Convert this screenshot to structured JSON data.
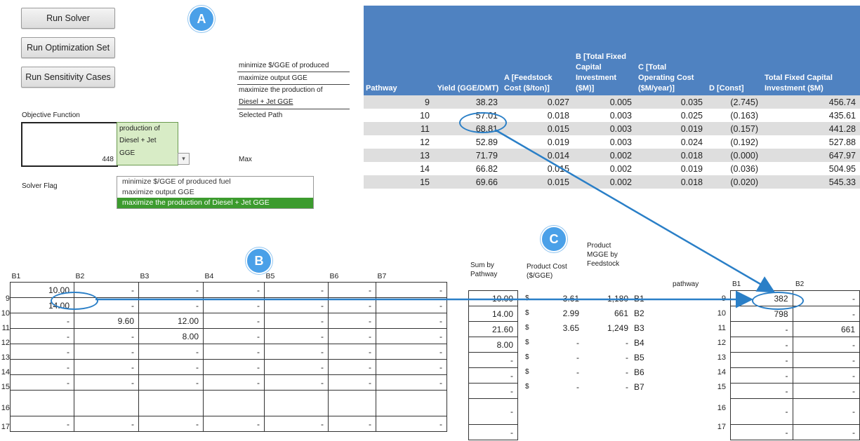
{
  "controls": {
    "run_solver": "Run Solver",
    "run_optimization_set": "Run Optimization Set",
    "run_sensitivity_cases": "Run Sensitivity Cases"
  },
  "objective": {
    "options": [
      "minimize $/GGE of produced",
      "maximize output GGE",
      "maximize the production of",
      "Diesel + Jet GGE"
    ],
    "selected_path_label": "Selected Path",
    "objective_function_label": "Objective Function",
    "value": "448",
    "dropdown_text": [
      "production of",
      "Diesel + Jet",
      "GGE"
    ],
    "max_label": "Max",
    "solver_flag_label": "Solver Flag",
    "list_options": [
      "minimize $/GGE of produced fuel",
      "maximize output GGE",
      "maximize the production of Diesel + Jet GGE"
    ]
  },
  "badges": {
    "a": "A",
    "b": "B",
    "c": "C"
  },
  "pathway_table": {
    "headers": [
      "Pathway",
      "Yield (GGE/DMT)",
      "A [Feedstock Cost ($/ton)]",
      "B [Total Fixed Capital Investment ($M)]",
      "C [Total Operating Cost ($M/year)]",
      "D [Const]",
      "Total Fixed Capital Investment ($M)"
    ],
    "rows": [
      [
        "9",
        "38.23",
        "0.027",
        "0.005",
        "0.035",
        "(2.745)",
        "456.74"
      ],
      [
        "10",
        "57.01",
        "0.018",
        "0.003",
        "0.025",
        "(0.163)",
        "435.61"
      ],
      [
        "11",
        "68.81",
        "0.015",
        "0.003",
        "0.019",
        "(0.157)",
        "441.28"
      ],
      [
        "12",
        "52.89",
        "0.019",
        "0.003",
        "0.024",
        "(0.192)",
        "527.88"
      ],
      [
        "13",
        "71.79",
        "0.014",
        "0.002",
        "0.018",
        "(0.000)",
        "647.97"
      ],
      [
        "14",
        "66.82",
        "0.015",
        "0.002",
        "0.019",
        "(0.036)",
        "504.95"
      ],
      [
        "15",
        "69.66",
        "0.015",
        "0.002",
        "0.018",
        "(0.020)",
        "545.33"
      ]
    ]
  },
  "b_grid": {
    "headers": [
      "B1",
      "B2",
      "B3",
      "B4",
      "B5",
      "B6",
      "B7"
    ],
    "row_labels": [
      "9",
      "10",
      "11",
      "12",
      "13",
      "14",
      "15",
      "16",
      "17"
    ],
    "rows": [
      [
        "10.00",
        "-",
        "-",
        "-",
        "-",
        "-",
        "-"
      ],
      [
        "14.00",
        "-",
        "-",
        "-",
        "-",
        "-",
        "-"
      ],
      [
        "-",
        "9.60",
        "12.00",
        "-",
        "-",
        "-",
        "-"
      ],
      [
        "-",
        "-",
        "8.00",
        "-",
        "-",
        "-",
        "-"
      ],
      [
        "-",
        "-",
        "-",
        "-",
        "-",
        "-",
        "-"
      ],
      [
        "-",
        "-",
        "-",
        "-",
        "-",
        "-",
        "-"
      ],
      [
        "-",
        "-",
        "-",
        "-",
        "-",
        "-",
        "-"
      ],
      [
        "",
        "",
        "",
        "",
        "",
        "",
        ""
      ],
      [
        "-",
        "-",
        "-",
        "-",
        "-",
        "-",
        "-"
      ]
    ]
  },
  "sum_column": {
    "header": "Sum by Pathway",
    "values": [
      "10.00",
      "14.00",
      "21.60",
      "8.00",
      "-",
      "-",
      "-",
      "-",
      "-"
    ]
  },
  "product_cost": {
    "header": "Product Cost ($/GGE)",
    "currency": "$",
    "values": [
      "3.61",
      "2.99",
      "3.65",
      "-",
      "-",
      "-",
      "-"
    ]
  },
  "mgge": {
    "header": "Product MGGE by Feedstock",
    "values": [
      "1,180",
      "661",
      "1,249",
      "-",
      "-",
      "-",
      "-"
    ],
    "labels": [
      "B1",
      "B2",
      "B3",
      "B4",
      "B5",
      "B6",
      "B7"
    ]
  },
  "result_grid": {
    "pathway_header": "pathway",
    "headers": [
      "B1",
      "B2"
    ],
    "row_labels": [
      "9",
      "10",
      "11",
      "12",
      "13",
      "14",
      "15",
      "16",
      "17"
    ],
    "rows": [
      [
        "382",
        "-"
      ],
      [
        "798",
        "-"
      ],
      [
        "-",
        "661"
      ],
      [
        "-",
        "-"
      ],
      [
        "-",
        "-"
      ],
      [
        "-",
        "-"
      ],
      [
        "-",
        "-"
      ],
      [
        "-",
        "-"
      ],
      [
        "-",
        "-"
      ]
    ]
  },
  "colors": {
    "table_header": "#4f82c1",
    "row_shade": "#dedede",
    "annotation": "#2a7fc7",
    "selection_green": "#3c9b2e",
    "dropdown_cell": "#d8ecc6"
  }
}
